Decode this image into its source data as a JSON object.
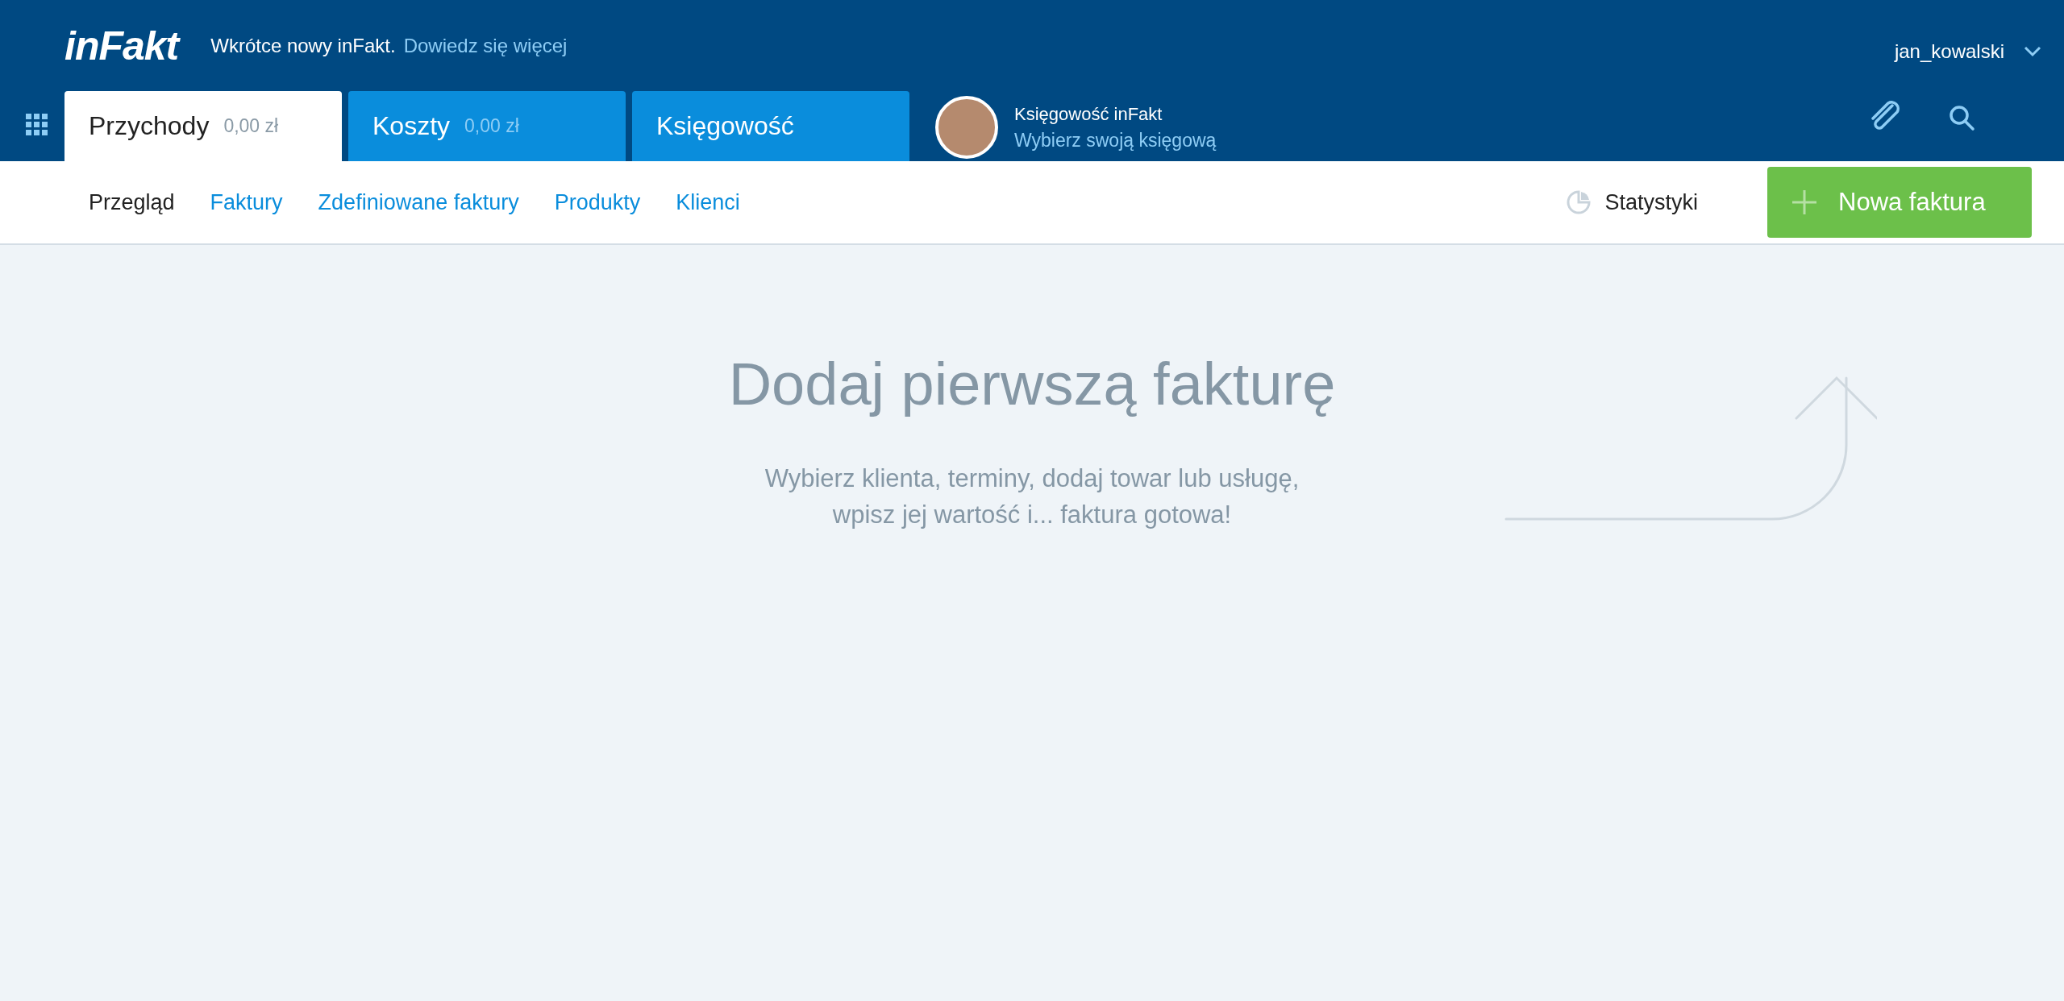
{
  "header": {
    "logo": "inFakt",
    "notice": "Wkrótce nowy inFakt.",
    "notice_link": "Dowiedz się więcej",
    "user": "jan_kowalski"
  },
  "tabs": [
    {
      "label": "Przychody",
      "amount": "0,00 zł",
      "selected": true
    },
    {
      "label": "Koszty",
      "amount": "0,00 zł",
      "selected": false
    },
    {
      "label": "Księgowość",
      "selected": false
    }
  ],
  "accountant": {
    "title": "Księgowość inFakt",
    "link": "Wybierz swoją księgową"
  },
  "subnav": [
    {
      "label": "Przegląd",
      "selected": true
    },
    {
      "label": "Faktury",
      "selected": false
    },
    {
      "label": "Zdefiniowane faktury",
      "selected": false
    },
    {
      "label": "Produkty",
      "selected": false
    },
    {
      "label": "Klienci",
      "selected": false
    }
  ],
  "stats_link": "Statystyki",
  "new_button": "Nowa faktura",
  "empty": {
    "title": "Dodaj pierwszą fakturę",
    "lines": [
      "Wybierz klienta, terminy, dodaj towar lub usługę,",
      "wpisz jej wartość i... faktura gotowa!"
    ]
  }
}
